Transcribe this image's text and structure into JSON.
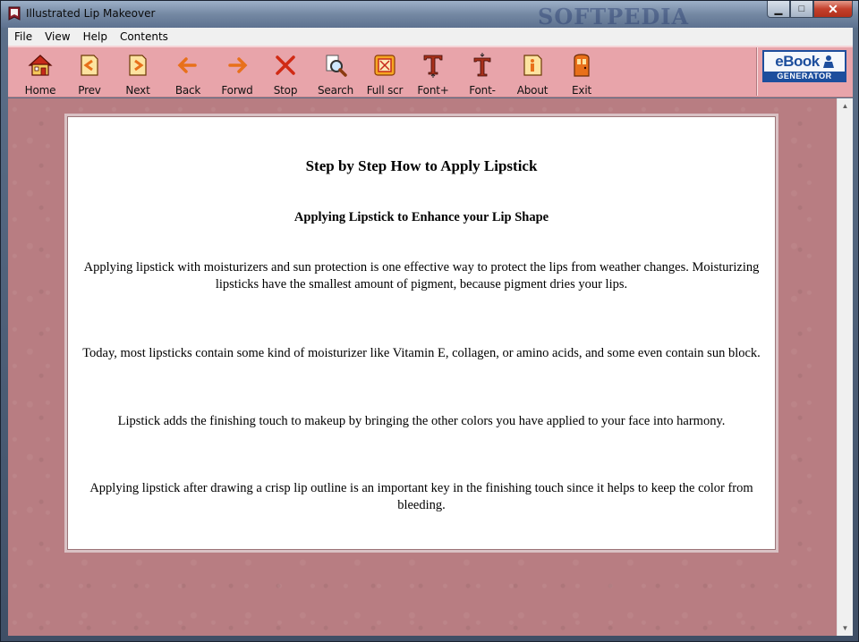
{
  "window": {
    "title": "Illustrated Lip Makeover",
    "watermark": "SOFTPEDIA",
    "minimize_glyph": "▁",
    "maximize_glyph": "□",
    "close_glyph": "✕"
  },
  "menu": {
    "items": [
      "File",
      "View",
      "Help",
      "Contents"
    ]
  },
  "toolbar": {
    "buttons": [
      {
        "label": "Home",
        "icon": "home-icon"
      },
      {
        "label": "Prev",
        "icon": "prev-page-icon"
      },
      {
        "label": "Next",
        "icon": "next-page-icon"
      },
      {
        "label": "Back",
        "icon": "back-arrow-icon"
      },
      {
        "label": "Forwd",
        "icon": "forward-arrow-icon"
      },
      {
        "label": "Stop",
        "icon": "stop-x-icon"
      },
      {
        "label": "Search",
        "icon": "search-icon"
      },
      {
        "label": "Full scr",
        "icon": "fullscreen-icon"
      },
      {
        "label": "Font+",
        "icon": "font-increase-icon"
      },
      {
        "label": "Font-",
        "icon": "font-decrease-icon"
      },
      {
        "label": "About",
        "icon": "about-icon"
      },
      {
        "label": "Exit",
        "icon": "exit-door-icon"
      }
    ],
    "logo": {
      "word": "eBook",
      "tagline": "GENERATOR"
    }
  },
  "page": {
    "title": "Step by Step How to Apply Lipstick",
    "subtitle": "Applying Lipstick to Enhance your Lip Shape",
    "paragraphs": [
      "Applying lipstick with moisturizers and sun protection is one effective way to protect the lips from weather changes. Moisturizing lipsticks have the smallest amount of pigment, because pigment dries your lips.",
      "Today, most lipsticks contain some kind of moisturizer like Vitamin E, collagen, or amino acids, and some even contain sun block.",
      "Lipstick adds the finishing touch to makeup by bringing the other colors you have applied to your face into harmony.",
      "Applying lipstick after drawing a crisp lip outline is an important key in the finishing touch since it helps to keep the color from bleeding."
    ]
  },
  "colors": {
    "toolbar_bg": "#e8a4aa",
    "content_bg": "#b87d82",
    "icon_orange": "#e8701a",
    "icon_red": "#c62a1a",
    "logo_blue": "#1d4e9d"
  }
}
